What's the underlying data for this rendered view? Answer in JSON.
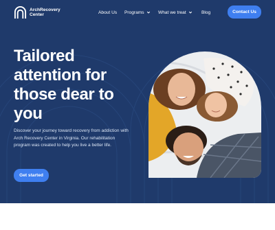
{
  "header": {
    "logo_line1": "ArchRecovery",
    "logo_line2": "Center",
    "nav": {
      "about": "About Us",
      "programs": "Programs",
      "what_we_treat": "What we treat",
      "blog": "Blog"
    },
    "contact_label": "Contact Us"
  },
  "hero": {
    "headline": "Tailored attention for those dear to you",
    "description": "Discover your journey toward recovery from addiction with Arch Recovery Center in Virginia. Our rehabilitation program was created to help you live a better life.",
    "cta_label": "Get started"
  },
  "icons": {
    "logo": "arch-logo-icon",
    "dropdown": "chevron-down-icon"
  },
  "colors": {
    "hero_background": "#1f3a6b",
    "accent": "#3f7ff0",
    "text": "#ffffff"
  }
}
